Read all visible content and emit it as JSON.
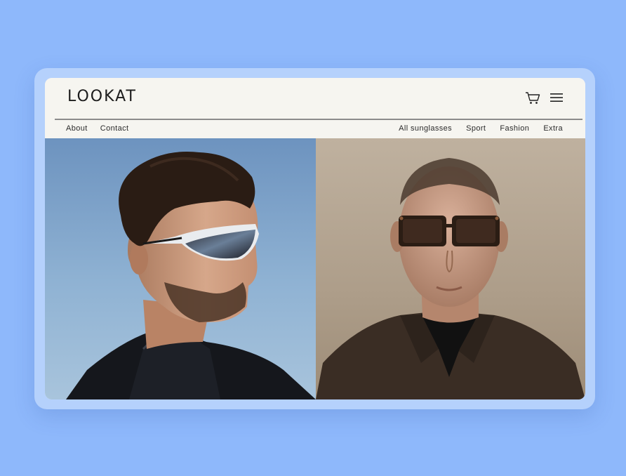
{
  "brand": {
    "logo_text": "LOOKAT"
  },
  "header": {
    "cart_icon": "cart-icon",
    "menu_icon": "hamburger-menu-icon"
  },
  "nav": {
    "left": [
      {
        "label": "About"
      },
      {
        "label": "Contact"
      }
    ],
    "right": [
      {
        "label": "All sunglasses"
      },
      {
        "label": "Sport"
      },
      {
        "label": "Fashion"
      },
      {
        "label": "Extra"
      }
    ]
  },
  "hero": {
    "left_image": "man-in-sport-sunglasses-photo",
    "right_image": "man-in-square-tinted-sunglasses-photo"
  },
  "colors": {
    "page_background": "#8eb8fb",
    "frame": "#b5d1fc",
    "window_background": "#f6f5f0",
    "text": "#1c1c1c"
  }
}
